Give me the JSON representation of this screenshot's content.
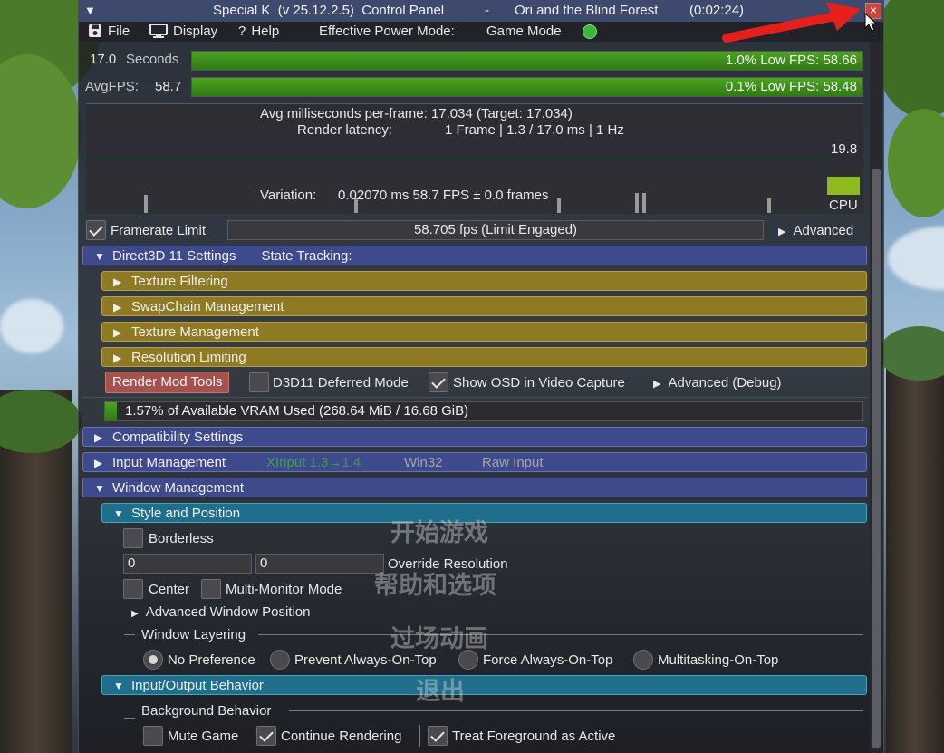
{
  "title_bar": {
    "app": "Special K  (v 25.12.2.5)  Control Panel",
    "separator": "-",
    "game": "Ori and the Blind Forest",
    "elapsed": "(0:02:24)",
    "close_symbol": "×"
  },
  "menu": {
    "file": "File",
    "display": "Display",
    "help": "Help",
    "power_label": "Effective Power Mode:",
    "power_value": "Game Mode"
  },
  "stats": {
    "seconds_value": "17.0",
    "seconds_label": "Seconds",
    "avgfps_label": "AvgFPS:",
    "avgfps_value": "58.7",
    "low1_text": "1.0% Low FPS: 58.66",
    "low1_fraction": 1.0,
    "low01_text": "0.1% Low FPS: 58.48",
    "low01_fraction": 1.0
  },
  "graph": {
    "avg_ms": "Avg milliseconds per-frame: 17.034  (Target: 17.034)",
    "latency_label": "Render latency:",
    "latency_value": "1 Frame   | 1.3 / 17.0 ms |  1 Hz",
    "max_value": "19.8",
    "variation_label": "Variation:",
    "variation_value": "0.02070 ms     58.7 FPS  ±  0.0 frames",
    "cpu_label": "CPU",
    "cpu_color": "#8dbb1e"
  },
  "framerate": {
    "label": "Framerate Limit",
    "checked": true,
    "value": "58.705 fps  (Limit Engaged)",
    "advanced": "Advanced"
  },
  "d3d11": {
    "header": "Direct3D 11 Settings",
    "state": "State Tracking:",
    "sub": [
      "Texture Filtering",
      "SwapChain Management",
      "Texture Management",
      "Resolution Limiting"
    ],
    "render_mod_tools": "Render Mod Tools",
    "deferred": "D3D11 Deferred Mode",
    "show_osd": "Show OSD in Video Capture",
    "advanced_debug": "Advanced (Debug)",
    "vram_text": "1.57% of Available VRAM Used     (268.64 MiB / 16.68 GiB)",
    "vram_fraction": 0.0157
  },
  "compat": {
    "header": "Compatibility Settings"
  },
  "input_mgmt": {
    "header": "Input Management",
    "xinput": "XInput 1.3→1.4",
    "win32": "Win32",
    "raw": "Raw Input"
  },
  "window_mgmt": {
    "header": "Window Management",
    "style_header": "Style and Position",
    "borderless": "Borderless",
    "res_w": "0",
    "res_h": "0",
    "override_res": "Override Resolution",
    "center": "Center",
    "multi_monitor": "Multi-Monitor Mode",
    "advanced_position": "Advanced Window Position",
    "layering_label": "Window Layering",
    "layering_options": [
      "No Preference",
      "Prevent Always-On-Top",
      "Force Always-On-Top",
      "Multitasking-On-Top"
    ],
    "io_header": "Input/Output Behavior",
    "background_label": "Background Behavior",
    "mute_game": "Mute Game",
    "continue_rendering": "Continue Rendering",
    "treat_foreground": "Treat Foreground as Active"
  },
  "game_menu": [
    "开始游戏",
    "帮助和选项",
    "过场动画",
    "退出"
  ],
  "colors": {
    "title_bar": "#3d4a6e",
    "header_blue": "#3e4a8c",
    "header_gold": "#8e7a22",
    "header_teal": "#1f6f8c",
    "fps_green": "#4ea321",
    "render_mod_button": "#a4524e",
    "annotation_arrow": "#e3201b"
  }
}
